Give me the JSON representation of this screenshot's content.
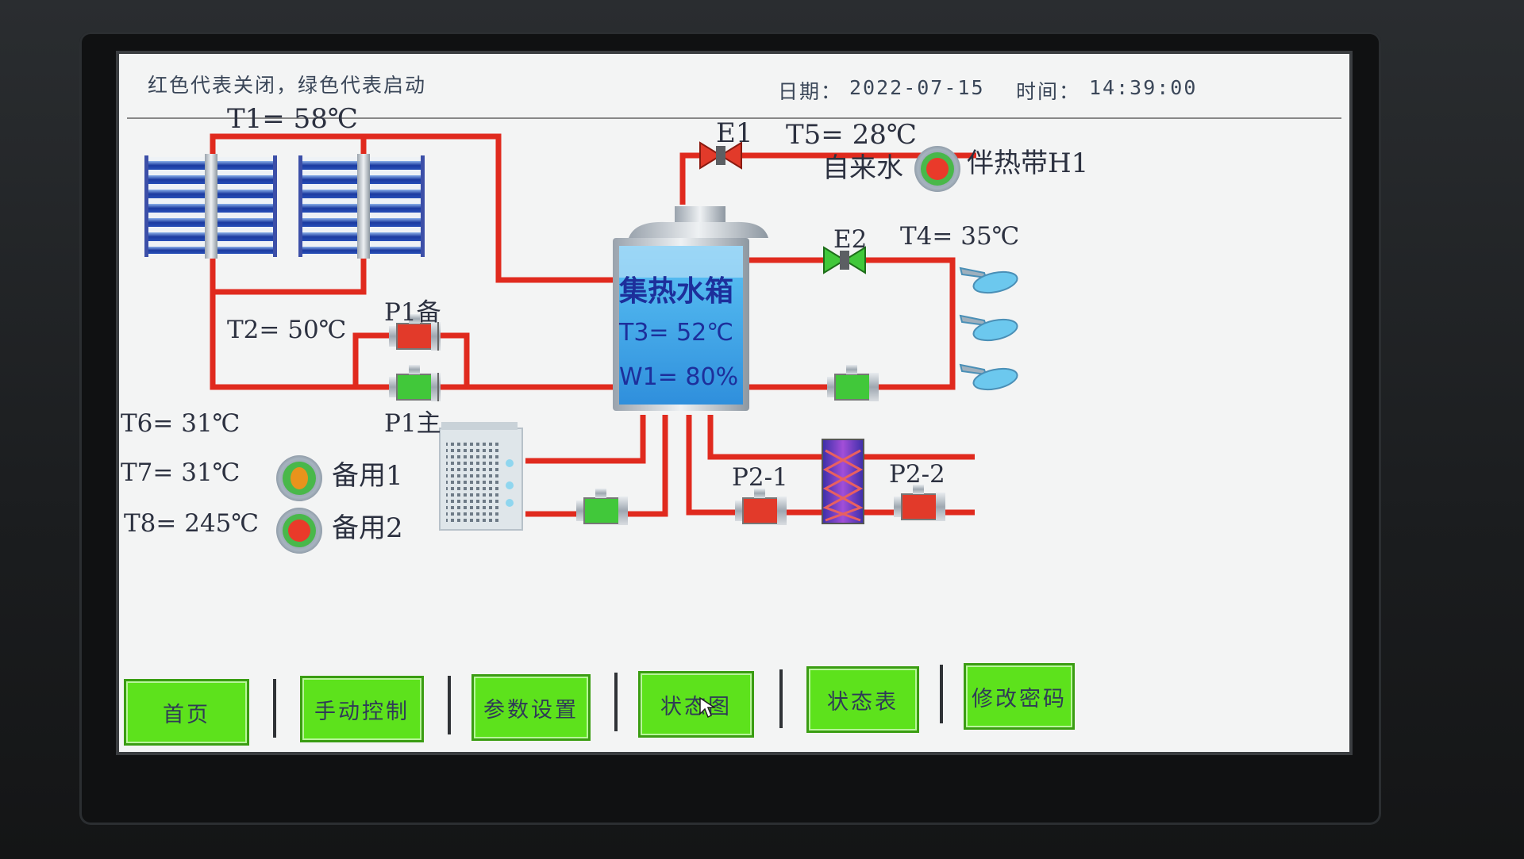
{
  "header": {
    "legend": "红色代表关闭，绿色代表启动",
    "date_label": "日期：",
    "date_value": "2022-07-15",
    "time_label": "时间：",
    "time_value": "14:39:00"
  },
  "sensors": {
    "t1": "T1= 58℃",
    "t2": "T2= 50℃",
    "t3": "T3= 52℃",
    "w1": "W1= 80%",
    "t4": "T4= 35℃",
    "t5": "T5= 28℃",
    "t6": "T6= 31℃",
    "t7": "T7= 31℃",
    "t8": "T8= 245℃"
  },
  "labels": {
    "tank": "集热水箱",
    "e1": "E1",
    "e2": "E2",
    "tap_water": "自来水",
    "heat_tape": "伴热带H1",
    "p1_backup": "P1备",
    "p1_main": "P1主",
    "p2_1": "P2-1",
    "p2_2": "P2-2",
    "spare1": "备用1",
    "spare2": "备用2"
  },
  "device_states": {
    "e1": "closed",
    "e2": "open",
    "p1_backup": "closed",
    "p1_main": "open",
    "p2_1": "closed",
    "p2_2": "closed",
    "return_pump": "open",
    "heat_pump_pump": "open",
    "heat_tape_h1": "off",
    "spare1": "standby",
    "spare2": "off"
  },
  "colors": {
    "pipe": "#e02a1e",
    "on": "#41c83a",
    "off": "#e23a2a",
    "button": "#5de21c",
    "panel_blue": "#1b3aa0",
    "water": "#4aa8ea"
  },
  "nav": [
    {
      "label": "首页"
    },
    {
      "label": "手动控制"
    },
    {
      "label": "参数设置"
    },
    {
      "label": "状态图"
    },
    {
      "label": "状态表"
    },
    {
      "label": "修改密码"
    }
  ]
}
